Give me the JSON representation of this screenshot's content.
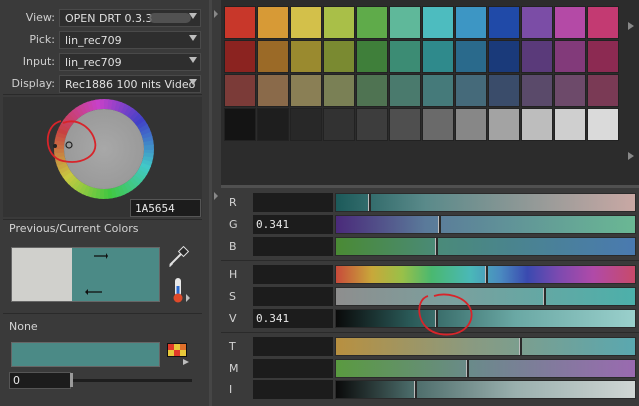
{
  "fields": [
    {
      "key": "view",
      "label": "View:",
      "value": "OPEN DRT 0.3.3"
    },
    {
      "key": "pick",
      "label": "Pick:",
      "value": "lin_rec709"
    },
    {
      "key": "input",
      "label": "Input:",
      "value": "lin_rec709"
    },
    {
      "key": "display",
      "label": "Display:",
      "value": "Rec1886 100 nits Video"
    }
  ],
  "hex_value": "1A5654",
  "prev_current_label": "Previous/Current Colors",
  "previous_color": "#d0d0cc",
  "current_color": "#4b8a86",
  "none_label": "None",
  "none_color": "#4b8a86",
  "number_value": "0",
  "swatch_rows": [
    [
      "#c8372a",
      "#d79a36",
      "#d3c04a",
      "#a9bf48",
      "#5fab4a",
      "#5fb89a",
      "#4dbcbf",
      "#3d96c4",
      "#204aa8",
      "#7b4da6",
      "#b44aa6",
      "#c33a72"
    ],
    [
      "#8b2320",
      "#9b6a27",
      "#9a8a2f",
      "#7a8a31",
      "#3f7f3a",
      "#3c8c74",
      "#2f8a8c",
      "#2a6a8c",
      "#1a3a7a",
      "#5a3a7a",
      "#823a7a",
      "#8c2a52"
    ],
    [
      "#7b3b38",
      "#8a6a4a",
      "#8a7f55",
      "#7a8055",
      "#4f7352",
      "#4a7a6d",
      "#457a7a",
      "#456a7a",
      "#3a4c6a",
      "#5a4a6a",
      "#6d4a6a",
      "#7a3a55"
    ],
    [
      "#141414",
      "#1e1e1e",
      "#282828",
      "#323232",
      "#3d3d3d",
      "#4f4f4f",
      "#6a6a6a",
      "#878787",
      "#a3a3a3",
      "#bdbdbd",
      "#cfcfcf",
      "#dadada"
    ]
  ],
  "sliders": [
    {
      "label": "R",
      "value": "",
      "handle": 0.108,
      "gradient": "linear-gradient(90deg,#1c5a5a 0%,#5a8a8a 30%,#c9a8a4 100%)"
    },
    {
      "label": "G",
      "value": "0.341",
      "handle": 0.342,
      "gradient": "linear-gradient(90deg,#4a2a7a 0%,#5a7a9a 30%,#6ab894 100%)"
    },
    {
      "label": "B",
      "value": "",
      "handle": 0.332,
      "gradient": "linear-gradient(90deg,#4a8a34 0%,#4a8a7a 35%,#4a7ab0 100%)"
    },
    {
      "label": "H",
      "value": "",
      "handle": 0.497,
      "gradient": "linear-gradient(90deg,#c84a3a 0%,#c8a83a 12%,#9ac048 22%,#4ab870 32%,#4ab8b8 45%,#4a8ac0 55%,#3a4ab0 64%,#7a4ab0 74%,#b04aa8 86%,#c84a6a 100%)"
    },
    {
      "label": "S",
      "value": "",
      "handle": 0.693,
      "gradient": "linear-gradient(90deg,#8e8e8e 0%,#7aa09e 40%,#4cb0aa 100%)"
    },
    {
      "label": "V",
      "value": "0.341",
      "handle": 0.332,
      "gradient": "linear-gradient(90deg,#0a0a0a 0%,#2a5a58 25%,#6aa8a4 60%,#9ad0cc 100%)"
    },
    {
      "label": "T",
      "value": "",
      "handle": 0.611,
      "gradient": "linear-gradient(90deg,#b89040 0%,#8a9a80 45%,#5aa8b0 100%)"
    },
    {
      "label": "M",
      "value": "",
      "handle": 0.436,
      "gradient": "linear-gradient(90deg,#5a9a40 0%,#6a8a8a 45%,#9a6ab0 100%)"
    },
    {
      "label": "I",
      "value": "",
      "handle": 0.262,
      "gradient": "linear-gradient(90deg,#0a0a0a 0%,#4a6a68 25%,#9ab0ae 60%,#d0d6d4 100%)"
    }
  ],
  "icons": {
    "eyedropper": "eyedropper-icon",
    "temperature": "thermometer-icon",
    "palette": "palette-swatch-icon"
  },
  "annotation_color": "#d8242a"
}
